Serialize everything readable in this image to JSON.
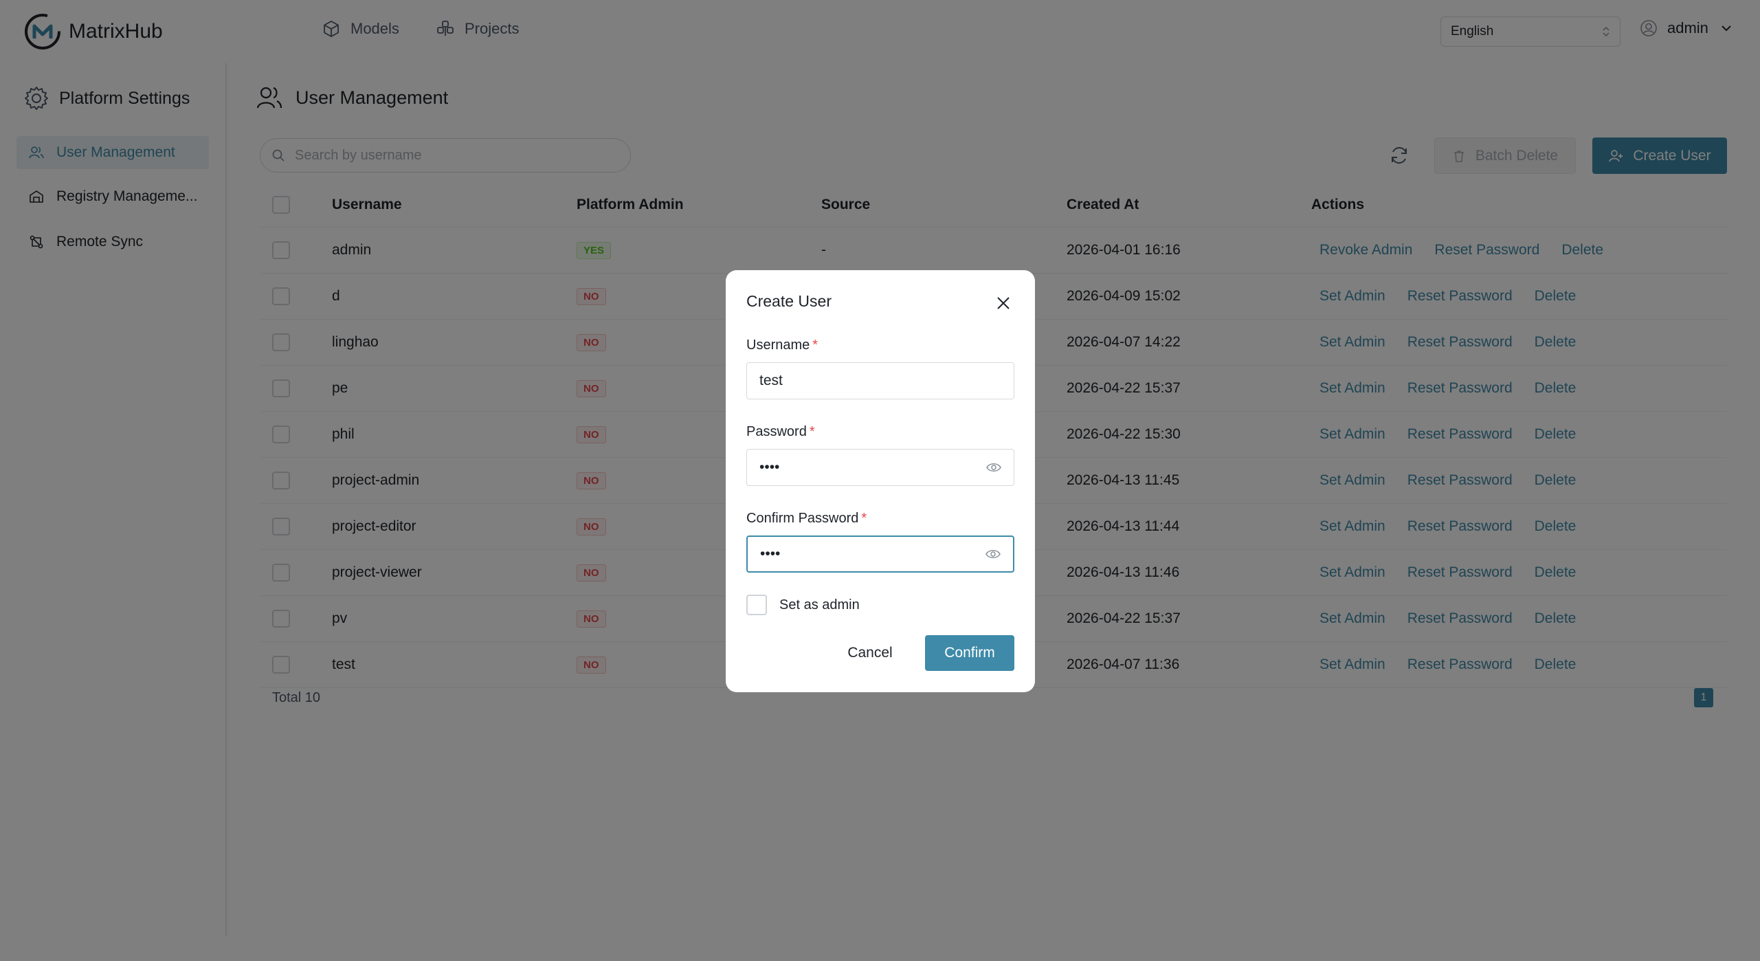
{
  "app": {
    "name": "MatrixHub"
  },
  "nav": {
    "models": "Models",
    "projects": "Projects"
  },
  "language": {
    "value": "English"
  },
  "user": {
    "name": "admin"
  },
  "sidebar": {
    "title": "Platform Settings",
    "items": [
      {
        "label": "User Management",
        "icon": "users-icon",
        "active": true
      },
      {
        "label": "Registry Manageme...",
        "icon": "registry-icon",
        "active": false
      },
      {
        "label": "Remote Sync",
        "icon": "sync-icon",
        "active": false
      }
    ]
  },
  "main": {
    "title": "User Management",
    "search_placeholder": "Search by username",
    "batch_delete": "Batch Delete",
    "create_user": "Create User"
  },
  "table": {
    "headers": {
      "username": "Username",
      "admin": "Platform Admin",
      "source": "Source",
      "created": "Created At",
      "actions": "Actions"
    },
    "rows": [
      {
        "username": "admin",
        "admin": "YES",
        "source": "-",
        "created": "2026-04-01 16:16",
        "a1": "Revoke Admin",
        "a2": "Reset Password",
        "a3": "Delete"
      },
      {
        "username": "d",
        "admin": "NO",
        "source": "",
        "created": "2026-04-09 15:02",
        "a1": "Set Admin",
        "a2": "Reset Password",
        "a3": "Delete"
      },
      {
        "username": "linghao",
        "admin": "NO",
        "source": "",
        "created": "2026-04-07 14:22",
        "a1": "Set Admin",
        "a2": "Reset Password",
        "a3": "Delete"
      },
      {
        "username": "pe",
        "admin": "NO",
        "source": "",
        "created": "2026-04-22 15:37",
        "a1": "Set Admin",
        "a2": "Reset Password",
        "a3": "Delete"
      },
      {
        "username": "phil",
        "admin": "NO",
        "source": "",
        "created": "2026-04-22 15:30",
        "a1": "Set Admin",
        "a2": "Reset Password",
        "a3": "Delete"
      },
      {
        "username": "project-admin",
        "admin": "NO",
        "source": "",
        "created": "2026-04-13 11:45",
        "a1": "Set Admin",
        "a2": "Reset Password",
        "a3": "Delete"
      },
      {
        "username": "project-editor",
        "admin": "NO",
        "source": "",
        "created": "2026-04-13 11:44",
        "a1": "Set Admin",
        "a2": "Reset Password",
        "a3": "Delete"
      },
      {
        "username": "project-viewer",
        "admin": "NO",
        "source": "",
        "created": "2026-04-13 11:46",
        "a1": "Set Admin",
        "a2": "Reset Password",
        "a3": "Delete"
      },
      {
        "username": "pv",
        "admin": "NO",
        "source": "",
        "created": "2026-04-22 15:37",
        "a1": "Set Admin",
        "a2": "Reset Password",
        "a3": "Delete"
      },
      {
        "username": "test",
        "admin": "NO",
        "source": "",
        "created": "2026-04-07 11:36",
        "a1": "Set Admin",
        "a2": "Reset Password",
        "a3": "Delete"
      }
    ]
  },
  "pagination": {
    "total": "Total 10",
    "current": "1"
  },
  "modal": {
    "title": "Create User",
    "username_label": "Username",
    "username_value": "test",
    "password_label": "Password",
    "password_value": "••••",
    "confirm_label": "Confirm Password",
    "confirm_value": "••••",
    "required_mark": "*",
    "admin_checkbox": "Set as admin",
    "cancel": "Cancel",
    "confirm": "Confirm"
  },
  "colors": {
    "primary": "#3e8aa8",
    "danger": "#e5484d",
    "success": "#52c41a"
  }
}
